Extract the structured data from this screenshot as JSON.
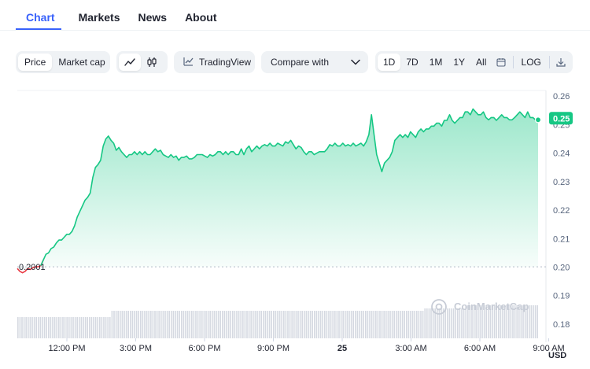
{
  "tabs": [
    {
      "label": "Chart",
      "active": true
    },
    {
      "label": "Markets",
      "active": false
    },
    {
      "label": "News",
      "active": false
    },
    {
      "label": "About",
      "active": false
    }
  ],
  "toolbar": {
    "price_label": "Price",
    "market_cap_label": "Market cap",
    "line_chart_icon": "line-chart-icon",
    "candle_chart_icon": "candlestick-icon",
    "tradingview_label": "TradingView",
    "compare_label": "Compare with",
    "ranges": [
      "1D",
      "7D",
      "1M",
      "1Y",
      "All"
    ],
    "active_range": "1D",
    "calendar_icon": "calendar-icon",
    "log_label": "LOG",
    "download_icon": "download-icon"
  },
  "colors": {
    "accent": "#3861fb",
    "up": "#16c784",
    "down": "#ea3943"
  },
  "chart_data": {
    "type": "area",
    "y_axis_ticks": [
      "0.26",
      "0.25",
      "0.24",
      "0.23",
      "0.22",
      "0.21",
      "0.20",
      "0.19",
      "0.18"
    ],
    "x_axis_ticks": [
      "12:00 PM",
      "3:00 PM",
      "6:00 PM",
      "9:00 PM",
      "25",
      "3:00 AM",
      "6:00 AM",
      "9:00 AM"
    ],
    "ylim": [
      0.175,
      0.262
    ],
    "open_price_label": "0.2001",
    "open_price": 0.2001,
    "current_price_label": "0.25",
    "current_price": 0.2517,
    "currency_label": "USD",
    "watermark": "CoinMarketCap",
    "series": [
      {
        "x": [
          0,
          0.5,
          1,
          1.5,
          2,
          2.5,
          3,
          3.5,
          4,
          4.5,
          5,
          5.5,
          6,
          6.5,
          7,
          7.5,
          8,
          8.5,
          9,
          9.5,
          10,
          10.5,
          11,
          11.5,
          12,
          12.5,
          13,
          13.5,
          14,
          14.5,
          15,
          15.5,
          16,
          16.5,
          17,
          17.5,
          18,
          18.5,
          19,
          19.5,
          20,
          20.5,
          21,
          21.5,
          22,
          22.5,
          23,
          23.5,
          24,
          24.5,
          25,
          25.5,
          26,
          26.5,
          27,
          27.5,
          28,
          28.5,
          29,
          29.5,
          30,
          30.5,
          31,
          31.5,
          32,
          32.5,
          33,
          33.5,
          34,
          34.5,
          35,
          35.5,
          36,
          36.5,
          37,
          37.5,
          38,
          38.5,
          39,
          39.5,
          40,
          40.5,
          41,
          41.5,
          42,
          42.5,
          43,
          43.5,
          44,
          44.5,
          45,
          45.5,
          46,
          46.5,
          47,
          47.5,
          48,
          48.5,
          49,
          49.5,
          50,
          50.5,
          51,
          51.5,
          52,
          52.5,
          53,
          53.5,
          54,
          54.5,
          55,
          55.5,
          56,
          56.5,
          57,
          57.5,
          58,
          58.5,
          59,
          59.5,
          60,
          60.5,
          61,
          61.5,
          62,
          62.5,
          63,
          63.5,
          64,
          64.5,
          65,
          65.5,
          66,
          66.5,
          67,
          67.5,
          68,
          68.5,
          69,
          69.5,
          70,
          70.5,
          71,
          71.5,
          72,
          72.5,
          73,
          73.5,
          74,
          74.5,
          75,
          75.5,
          76,
          76.5,
          77,
          77.5,
          78,
          78.5,
          79,
          79.5,
          80,
          80.5,
          81,
          81.5,
          82,
          82.5,
          83,
          83.5,
          84,
          84.5,
          85,
          85.5,
          86,
          86.5,
          87,
          87.5,
          88,
          88.5,
          89,
          89.5,
          90,
          90.5,
          91,
          91.5,
          92,
          92.5,
          93,
          93.5,
          94,
          94.5,
          95,
          95.5,
          96,
          96.5,
          97,
          97.5,
          98,
          98.5,
          99,
          99.5,
          100
        ],
        "values": [
          0.1995,
          0.1985,
          0.198,
          0.1985,
          0.1995,
          0.1992,
          0.1998,
          0.2001,
          0.2001,
          0.2005,
          0.2025,
          0.2045,
          0.205,
          0.2065,
          0.207,
          0.2085,
          0.2095,
          0.2095,
          0.2105,
          0.2115,
          0.2115,
          0.2125,
          0.2145,
          0.2175,
          0.2195,
          0.2215,
          0.2235,
          0.2245,
          0.226,
          0.2315,
          0.235,
          0.236,
          0.2375,
          0.2425,
          0.245,
          0.246,
          0.2445,
          0.2435,
          0.241,
          0.242,
          0.2405,
          0.2395,
          0.2385,
          0.2395,
          0.2395,
          0.2405,
          0.2395,
          0.2405,
          0.2395,
          0.2405,
          0.2395,
          0.2395,
          0.2405,
          0.2415,
          0.2405,
          0.241,
          0.2395,
          0.239,
          0.2385,
          0.2395,
          0.2385,
          0.239,
          0.2375,
          0.2385,
          0.2385,
          0.239,
          0.238,
          0.238,
          0.2385,
          0.2395,
          0.2395,
          0.2395,
          0.239,
          0.2385,
          0.2395,
          0.239,
          0.2395,
          0.2405,
          0.2405,
          0.2395,
          0.2405,
          0.2395,
          0.2405,
          0.2405,
          0.2395,
          0.2395,
          0.2415,
          0.2395,
          0.2415,
          0.2425,
          0.2405,
          0.2415,
          0.2425,
          0.2415,
          0.2425,
          0.243,
          0.2425,
          0.2435,
          0.2425,
          0.2425,
          0.2435,
          0.243,
          0.2425,
          0.244,
          0.2435,
          0.2445,
          0.243,
          0.2415,
          0.2425,
          0.242,
          0.2405,
          0.2395,
          0.2405,
          0.2405,
          0.2395,
          0.24,
          0.2405,
          0.2405,
          0.2405,
          0.2415,
          0.243,
          0.2425,
          0.2435,
          0.2425,
          0.2425,
          0.2435,
          0.2425,
          0.243,
          0.2425,
          0.2435,
          0.2425,
          0.243,
          0.2435,
          0.2425,
          0.244,
          0.2465,
          0.2535,
          0.2465,
          0.2395,
          0.2365,
          0.2335,
          0.2365,
          0.2375,
          0.2385,
          0.2405,
          0.2445,
          0.2455,
          0.2465,
          0.2455,
          0.2465,
          0.2455,
          0.2475,
          0.2465,
          0.2455,
          0.2475,
          0.2485,
          0.2475,
          0.2485,
          0.2485,
          0.2495,
          0.2495,
          0.2505,
          0.2505,
          0.2495,
          0.2515,
          0.2515,
          0.2535,
          0.2515,
          0.2505,
          0.2515,
          0.2525,
          0.2525,
          0.2545,
          0.2545,
          0.2535,
          0.2555,
          0.2545,
          0.2535,
          0.2535,
          0.2545,
          0.2525,
          0.2517,
          0.2525,
          0.2525,
          0.2515,
          0.2525,
          0.2535,
          0.2525,
          0.2525,
          0.2517,
          0.2517,
          0.2525,
          0.2535,
          0.2545,
          0.2535,
          0.2525,
          0.2545,
          0.2525,
          0.2525,
          0.2517,
          0.2517
        ]
      }
    ]
  }
}
